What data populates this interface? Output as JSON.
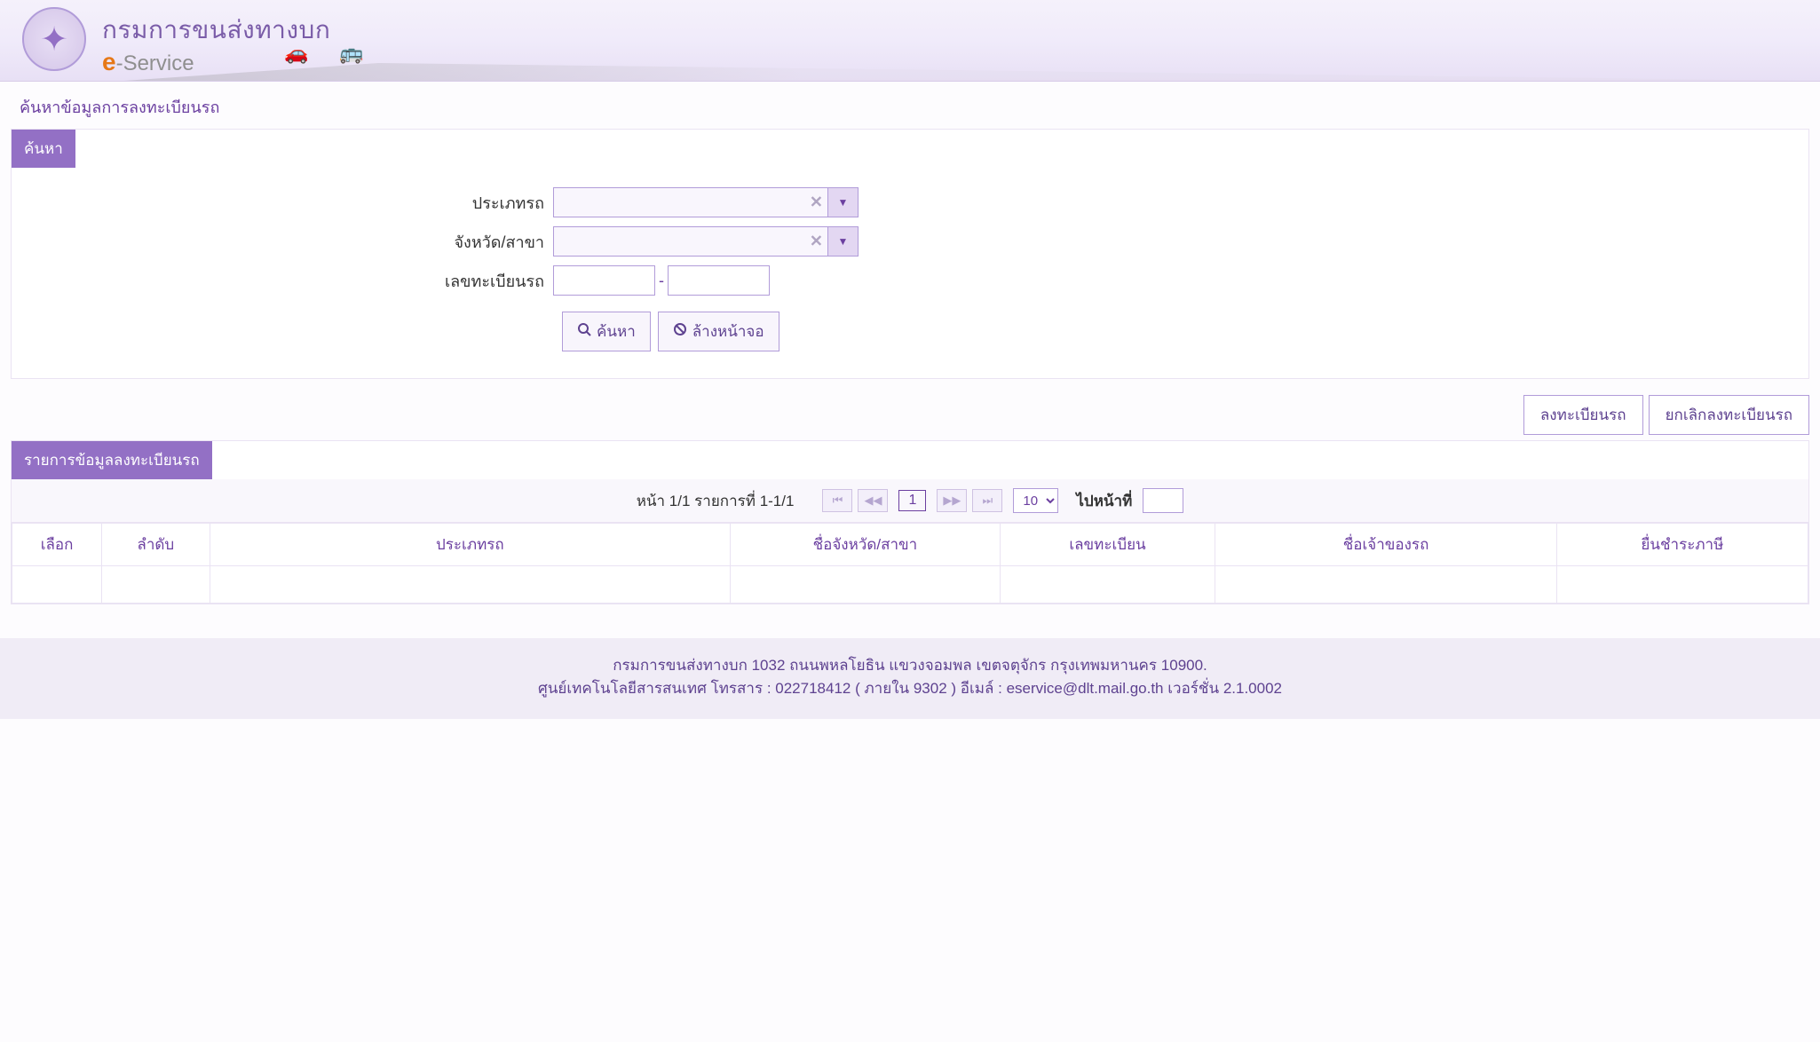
{
  "header": {
    "title": "กรมการขนส่งทางบก",
    "subtitle_e": "e",
    "subtitle_rest": "-Service"
  },
  "page_title": "ค้นหาข้อมูลการลงทะเบียนรถ",
  "search_panel": {
    "title": "ค้นหา",
    "labels": {
      "vehicle_type": "ประเภทรถ",
      "province": "จังหวัด/สาขา",
      "plate": "เลขทะเบียนรถ"
    },
    "values": {
      "vehicle_type": "",
      "province": "",
      "plate1": "",
      "plate2": ""
    },
    "buttons": {
      "search": "ค้นหา",
      "clear": "ล้างหน้าจอ"
    }
  },
  "actions": {
    "register": "ลงทะเบียนรถ",
    "cancel": "ยกเลิกลงทะเบียนรถ"
  },
  "list_panel": {
    "title": "รายการข้อมูลลงทะเบียนรถ",
    "paginator": {
      "info": "หน้า 1/1 รายการที่ 1-1/1",
      "current_page": "1",
      "page_size": "10",
      "goto_label": "ไปหน้าที่",
      "goto_value": ""
    },
    "columns": [
      "เลือก",
      "ลำดับ",
      "ประเภทรถ",
      "ชื่อจังหวัด/สาขา",
      "เลขทะเบียน",
      "ชื่อเจ้าของรถ",
      "ยื่นชำระภาษี"
    ],
    "rows": [
      [
        "",
        "",
        "",
        "",
        "",
        "",
        ""
      ]
    ]
  },
  "footer": {
    "line1": "กรมการขนส่งทางบก 1032 ถนนพหลโยธิน แขวงจอมพล เขตจตุจักร กรุงเทพมหานคร 10900.",
    "line2": "ศูนย์เทคโนโลยีสารสนเทศ โทรสาร : 022718412 ( ภายใน 9302 ) อีเมล์ : eservice@dlt.mail.go.th เวอร์ชั่น 2.1.0002"
  }
}
